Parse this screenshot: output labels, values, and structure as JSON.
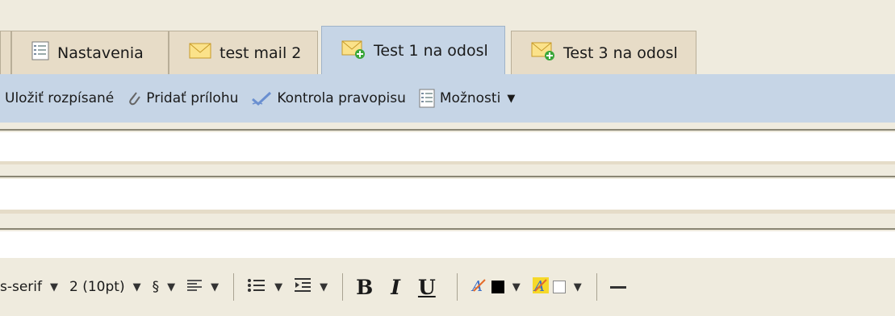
{
  "tabs": [
    {
      "label": "",
      "icon": "document-icon"
    },
    {
      "label": "Nastavenia",
      "icon": "settings-list-icon"
    },
    {
      "label": "test mail 2",
      "icon": "envelope-icon"
    },
    {
      "label": "Test 1 na odosl",
      "icon": "envelope-new-icon",
      "active": true
    },
    {
      "label": "Test 3 na odosl",
      "icon": "envelope-new-icon"
    }
  ],
  "toolbar": {
    "save_draft": "Uložiť rozpísané",
    "attach": "Pridať prílohu",
    "spellcheck": "Kontrola pravopisu",
    "options": "Možnosti"
  },
  "format": {
    "font_family": "s-serif",
    "font_size": "2 (10pt)",
    "paragraph": "§",
    "bold": "B",
    "italic": "I",
    "underline": "U",
    "text_color": "#000000",
    "highlight_color": "#ffffff"
  },
  "colors": {
    "background": "#efebde",
    "toolbar": "#c6d5e6",
    "tab": "#e7dcc7"
  }
}
